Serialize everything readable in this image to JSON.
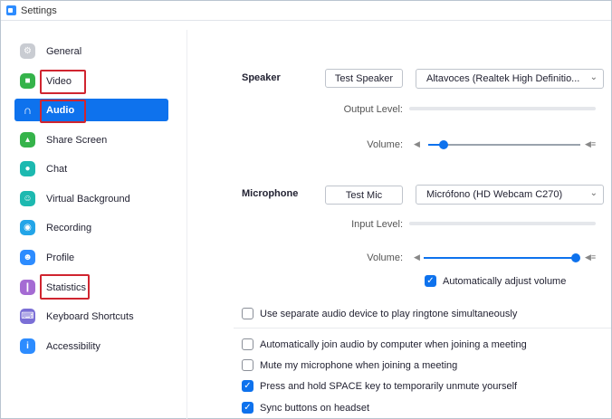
{
  "window": {
    "title": "Settings"
  },
  "sidebar": {
    "items": [
      {
        "label": "General",
        "icon": "gear-icon",
        "color": "#c9ccd2",
        "glyph": "⚙"
      },
      {
        "label": "Video",
        "icon": "video-camera-icon",
        "color": "#35b34a",
        "glyph": "■"
      },
      {
        "label": "Audio",
        "icon": "headphones-icon",
        "color": "#0e72ed",
        "glyph": "∩"
      },
      {
        "label": "Share Screen",
        "icon": "share-screen-icon",
        "color": "#35b34a",
        "glyph": "▴"
      },
      {
        "label": "Chat",
        "icon": "chat-bubble-icon",
        "color": "#1db9b0",
        "glyph": "●"
      },
      {
        "label": "Virtual Background",
        "icon": "person-background-icon",
        "color": "#1db9b0",
        "glyph": "☺"
      },
      {
        "label": "Recording",
        "icon": "recording-icon",
        "color": "#23a5e8",
        "glyph": "◉"
      },
      {
        "label": "Profile",
        "icon": "profile-icon",
        "color": "#2d8cff",
        "glyph": "☻"
      },
      {
        "label": "Statistics",
        "icon": "bar-chart-icon",
        "color": "#a56bd3",
        "glyph": "❙"
      },
      {
        "label": "Keyboard Shortcuts",
        "icon": "keyboard-icon",
        "color": "#7b6fd6",
        "glyph": "⌨"
      },
      {
        "label": "Accessibility",
        "icon": "accessibility-icon",
        "color": "#2d8cff",
        "glyph": "i"
      }
    ],
    "active": "Audio",
    "highlight_color": "#d0252f"
  },
  "speaker": {
    "section_label": "Speaker",
    "test_button": "Test Speaker",
    "device": "Altavoces (Realtek High Definitio...",
    "output_level_label": "Output Level:",
    "volume_label": "Volume:",
    "volume_level": 0.1
  },
  "microphone": {
    "section_label": "Microphone",
    "test_button": "Test Mic",
    "device": "Micrófono (HD Webcam C270)",
    "input_level_label": "Input Level:",
    "volume_label": "Volume:",
    "volume_level": 1.0,
    "auto_adjust_label": "Automatically adjust volume",
    "auto_adjust_checked": true
  },
  "options": [
    {
      "label": "Use separate audio device to play ringtone simultaneously",
      "checked": false
    },
    {
      "label": "Automatically join audio by computer when joining a meeting",
      "checked": false
    },
    {
      "label": "Mute my microphone when joining a meeting",
      "checked": false
    },
    {
      "label": "Press and hold SPACE key to temporarily unmute yourself",
      "checked": true
    },
    {
      "label": "Sync buttons on headset",
      "checked": true
    }
  ],
  "colors": {
    "accent": "#0e72ed"
  }
}
